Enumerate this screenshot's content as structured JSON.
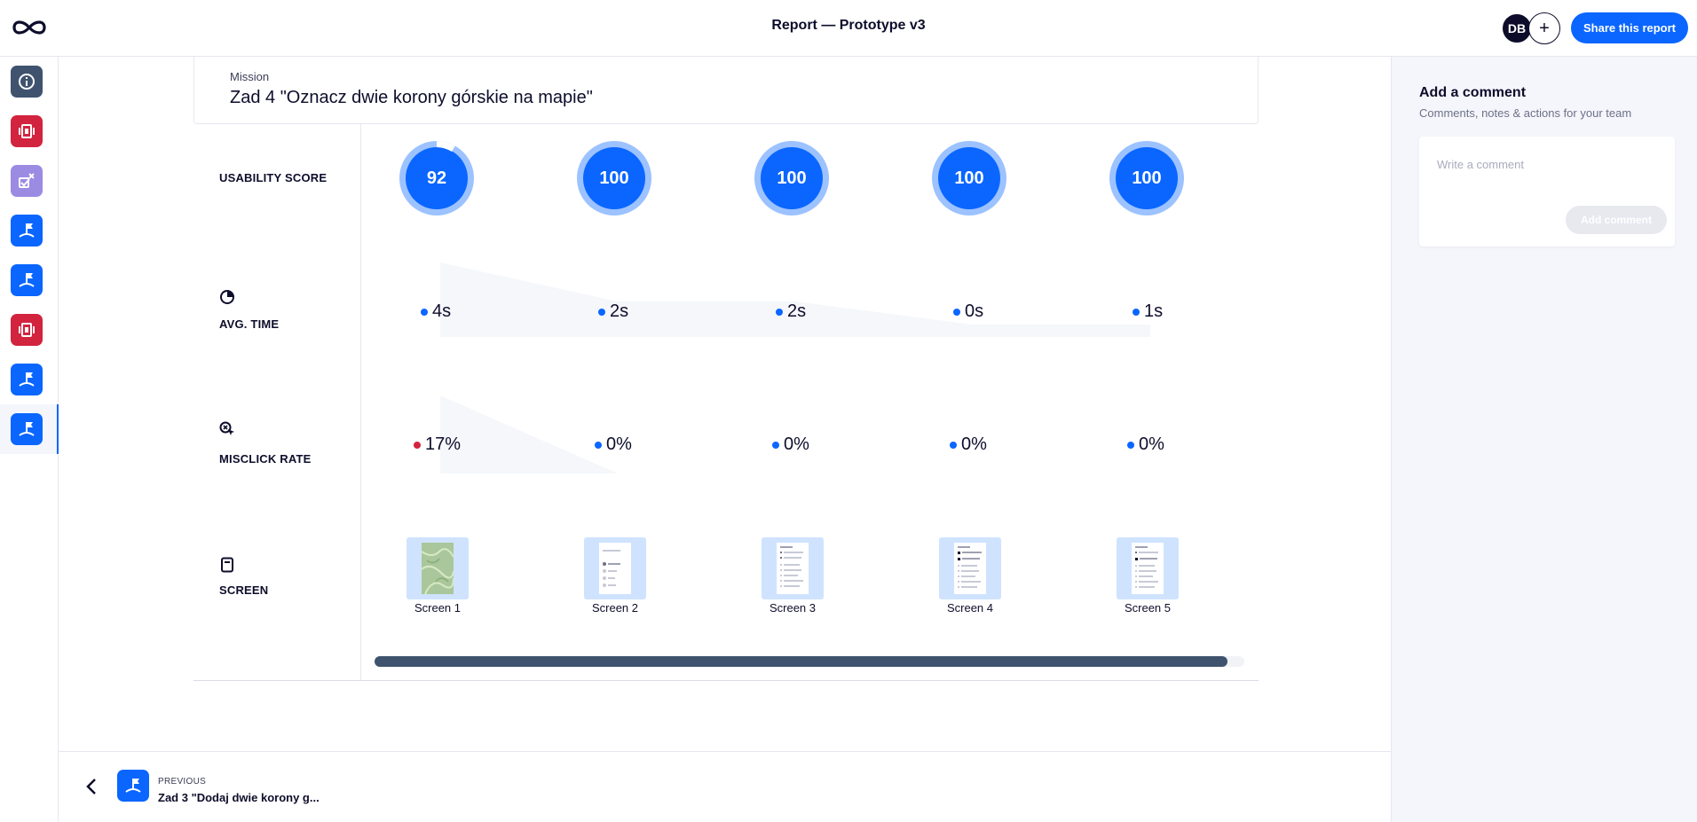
{
  "header": {
    "title": "Report — Prototype v3",
    "avatar_initials": "DB",
    "add_member_symbol": "+",
    "share_label": "Share this report"
  },
  "sidebar": {
    "items": [
      {
        "icon": "info-icon",
        "color": "#3f536e",
        "active": false
      },
      {
        "icon": "split-screen-icon",
        "color": "#d2233f",
        "active": false
      },
      {
        "icon": "checklist-icon",
        "color": "#9b8be3",
        "active": false
      },
      {
        "icon": "flag-icon",
        "color": "#0a66ff",
        "active": false
      },
      {
        "icon": "flag-icon",
        "color": "#0a66ff",
        "active": false
      },
      {
        "icon": "split-screen-icon",
        "color": "#d2233f",
        "active": false
      },
      {
        "icon": "flag-icon",
        "color": "#0a66ff",
        "active": false
      },
      {
        "icon": "flag-icon",
        "color": "#0a66ff",
        "active": true
      }
    ]
  },
  "mission": {
    "label": "Mission",
    "title": "Zad 4 \"Oznacz dwie korony górskie na mapie\""
  },
  "rows": {
    "usability_score": "USABILITY SCORE",
    "avg_time": "AVG. TIME",
    "misclick_rate": "MISCLICK RATE",
    "screen": "SCREEN"
  },
  "screens": [
    {
      "score": 92,
      "score_text": "92",
      "avg_time": "4s",
      "misclick": "17%",
      "misclick_status": "high",
      "label": "Screen 1"
    },
    {
      "score": 100,
      "score_text": "100",
      "avg_time": "2s",
      "misclick": "0%",
      "misclick_status": "ok",
      "label": "Screen 2"
    },
    {
      "score": 100,
      "score_text": "100",
      "avg_time": "2s",
      "misclick": "0%",
      "misclick_status": "ok",
      "label": "Screen 3"
    },
    {
      "score": 100,
      "score_text": "100",
      "avg_time": "0s",
      "misclick": "0%",
      "misclick_status": "ok",
      "label": "Screen 4"
    },
    {
      "score": 100,
      "score_text": "100",
      "avg_time": "1s",
      "misclick": "0%",
      "misclick_status": "ok",
      "label": "Screen 5"
    }
  ],
  "footer": {
    "kicker": "PREVIOUS",
    "title": "Zad 3 \"Dodaj dwie korony g..."
  },
  "comments": {
    "title": "Add a comment",
    "subtitle": "Comments, notes & actions for your team",
    "placeholder": "Write a comment",
    "button_label": "Add comment"
  },
  "colors": {
    "accent": "#0a66ff",
    "ring_light": "#9cc2ff",
    "danger": "#d2233f",
    "scrollbar": "#3f536e"
  }
}
